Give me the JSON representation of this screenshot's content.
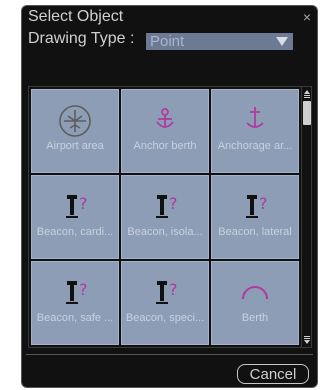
{
  "dialog": {
    "title": "Select Object",
    "close_glyph": "×",
    "drawing_type_label": "Drawing Type :",
    "drawing_type_value": "Point",
    "cancel_label": "Cancel"
  },
  "objects": [
    {
      "label": "Airport area",
      "icon": "airport-icon"
    },
    {
      "label": "Anchor berth",
      "icon": "anchor-berth-icon"
    },
    {
      "label": "Anchorage ar...",
      "icon": "anchorage-icon"
    },
    {
      "label": "Beacon, cardi...",
      "icon": "beacon-icon"
    },
    {
      "label": "Beacon, isola...",
      "icon": "beacon-icon"
    },
    {
      "label": "Beacon, lateral",
      "icon": "beacon-icon"
    },
    {
      "label": "Beacon, safe ...",
      "icon": "beacon-icon"
    },
    {
      "label": "Beacon, speci...",
      "icon": "beacon-icon"
    },
    {
      "label": "Berth",
      "icon": "berth-icon"
    }
  ],
  "colors": {
    "cell_bg": "#8d9db6",
    "magenta": "#b03aa0",
    "label": "#c8d1de"
  }
}
